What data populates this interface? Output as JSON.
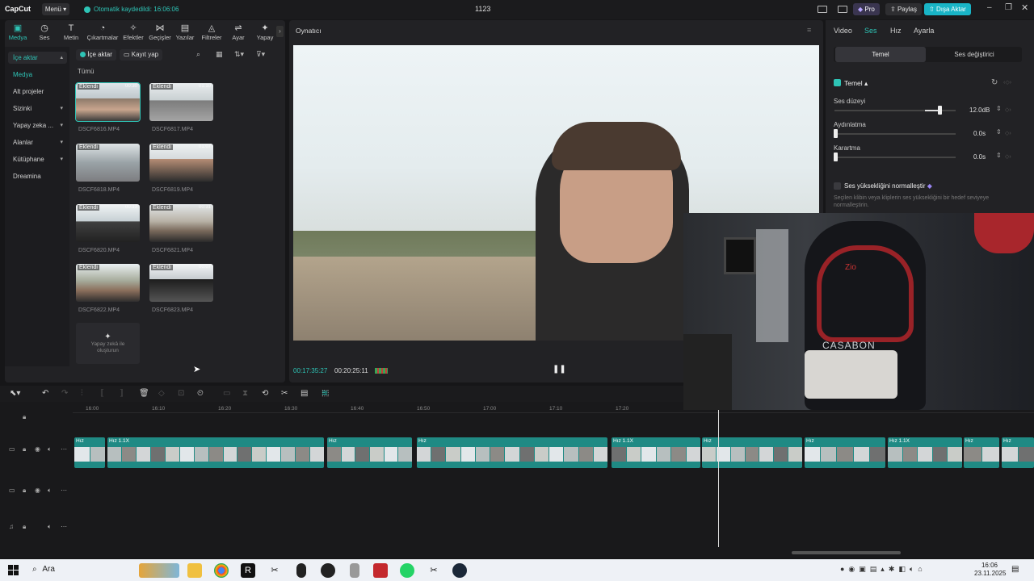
{
  "app": {
    "logo": "CapCut",
    "menu_label": "Menü",
    "autosave": "Otomatik kaydedildi: 16:06:06",
    "project_title": "1123",
    "pro_label": "Pro",
    "share_label": "Paylaş",
    "export_label": "Dışa Aktar"
  },
  "toolbar": [
    {
      "label": "Medya",
      "icon": "media-icon"
    },
    {
      "label": "Ses",
      "icon": "audio-icon"
    },
    {
      "label": "Metin",
      "icon": "text-icon"
    },
    {
      "label": "Çıkartmalar",
      "icon": "sticker-icon"
    },
    {
      "label": "Efektler",
      "icon": "effects-icon"
    },
    {
      "label": "Geçişler",
      "icon": "transition-icon"
    },
    {
      "label": "Yazılar",
      "icon": "captions-icon"
    },
    {
      "label": "Filtreler",
      "icon": "filter-icon"
    },
    {
      "label": "Ayar",
      "icon": "adjust-icon"
    },
    {
      "label": "Yapay",
      "icon": "ai-icon"
    }
  ],
  "sidebar": [
    {
      "label": "İçe aktar",
      "chev": "▴"
    },
    {
      "label": "Medya",
      "chev": ""
    },
    {
      "label": "Alt projeler",
      "chev": ""
    },
    {
      "label": "Sizinki",
      "chev": "▾"
    },
    {
      "label": "Yapay zeka ...",
      "chev": "▾"
    },
    {
      "label": "Alanlar",
      "chev": "▾"
    },
    {
      "label": "Kütüphane",
      "chev": "▾"
    },
    {
      "label": "Dreamina",
      "chev": ""
    }
  ],
  "media": {
    "import_btn": "İçe aktar",
    "record_btn": "Kayıt yap",
    "section_title": "Tümü",
    "added_tag": "Eklendi",
    "ai_create": "Yapay zekâ ile oluşturun",
    "items": [
      {
        "name": "DSCF6816.MP4",
        "dur": "00:30"
      },
      {
        "name": "DSCF6817.MP4",
        "dur": "01:10"
      },
      {
        "name": "DSCF6818.MP4",
        "dur": ""
      },
      {
        "name": "DSCF6819.MP4",
        "dur": "01:07"
      },
      {
        "name": "DSCF6820.MP4",
        "dur": "00:13"
      },
      {
        "name": "DSCF6821.MP4",
        "dur": "00:31"
      },
      {
        "name": "DSCF6822.MP4",
        "dur": ""
      },
      {
        "name": "DSCF6823.MP4",
        "dur": "00:07"
      }
    ]
  },
  "player": {
    "title": "Oynatıcı",
    "current_time": "00:17:35:27",
    "total_time": "00:20:25:11"
  },
  "inspector": {
    "tabs": [
      "Video",
      "Ses",
      "Hız",
      "Ayarla"
    ],
    "active_tab": "Ses",
    "segments": [
      "Temel",
      "Ses değiştirici"
    ],
    "section": "Temel",
    "volume_label": "Ses düzeyi",
    "volume_value": "12.0dB",
    "fadein_label": "Aydınlatma",
    "fadein_value": "0.0s",
    "fadeout_label": "Karartma",
    "fadeout_value": "0.0s",
    "normalize_label": "Ses yüksekliğini normalleştir",
    "normalize_desc": "Seçilen klibin veya kliplerin ses yüksekliğini bir hedef seviyeye normalleştirin."
  },
  "timeline": {
    "ruler": [
      "16:00",
      "16:10",
      "16:20",
      "16:30",
      "16:40",
      "16:50",
      "17:00",
      "17:10",
      "17:20"
    ],
    "speed_tag": "Hız",
    "speed_tag_long": "Hız 1.1X"
  },
  "webcam": {
    "chair_text": "CASABON"
  },
  "taskbar": {
    "search": "Ara",
    "time": "16:06",
    "date": "23.11.2025"
  },
  "colors": {
    "accent": "#2ec4b6",
    "clip": "#1f8a84",
    "pro": "#3a3550",
    "export": "#19b4c6"
  }
}
